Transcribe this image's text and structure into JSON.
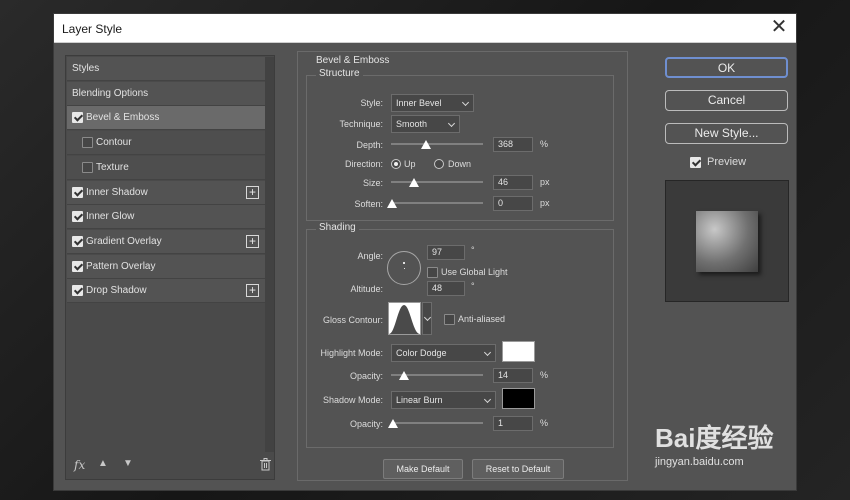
{
  "dialog": {
    "title": "Layer Style"
  },
  "styles_list": {
    "items": [
      {
        "label": "Styles",
        "checkbox": false,
        "checked": false,
        "plus": false,
        "active": false,
        "sub": false
      },
      {
        "label": "Blending Options",
        "checkbox": false,
        "checked": false,
        "plus": false,
        "active": false,
        "sub": false
      },
      {
        "label": "Bevel & Emboss",
        "checkbox": true,
        "checked": true,
        "plus": false,
        "active": true,
        "sub": false
      },
      {
        "label": "Contour",
        "checkbox": true,
        "checked": false,
        "plus": false,
        "active": false,
        "sub": true
      },
      {
        "label": "Texture",
        "checkbox": true,
        "checked": false,
        "plus": false,
        "active": false,
        "sub": true
      },
      {
        "label": "Inner Shadow",
        "checkbox": true,
        "checked": true,
        "plus": true,
        "active": false,
        "sub": false
      },
      {
        "label": "Inner Glow",
        "checkbox": true,
        "checked": true,
        "plus": false,
        "active": false,
        "sub": false
      },
      {
        "label": "Gradient Overlay",
        "checkbox": true,
        "checked": true,
        "plus": true,
        "active": false,
        "sub": false
      },
      {
        "label": "Pattern Overlay",
        "checkbox": true,
        "checked": true,
        "plus": false,
        "active": false,
        "sub": false
      },
      {
        "label": "Drop Shadow",
        "checkbox": true,
        "checked": true,
        "plus": true,
        "active": false,
        "sub": false
      }
    ],
    "fx_label": "fx"
  },
  "bevel": {
    "title": "Bevel & Emboss",
    "structure": {
      "title": "Structure",
      "style_label": "Style:",
      "style_value": "Inner Bevel",
      "technique_label": "Technique:",
      "technique_value": "Smooth",
      "depth_label": "Depth:",
      "depth_value": "368",
      "depth_unit": "%",
      "direction_label": "Direction:",
      "direction_up": "Up",
      "direction_down": "Down",
      "direction_selected": "Up",
      "size_label": "Size:",
      "size_value": "46",
      "size_unit": "px",
      "soften_label": "Soften:",
      "soften_value": "0",
      "soften_unit": "px"
    },
    "shading": {
      "title": "Shading",
      "angle_label": "Angle:",
      "angle_value": "97",
      "angle_unit": "°",
      "global_light_label": "Use Global Light",
      "global_light_checked": false,
      "altitude_label": "Altitude:",
      "altitude_value": "48",
      "altitude_unit": "°",
      "gloss_label": "Gloss Contour:",
      "antialiased_label": "Anti-aliased",
      "antialiased_checked": false,
      "highlight_mode_label": "Highlight Mode:",
      "highlight_mode_value": "Color Dodge",
      "highlight_color": "#ffffff",
      "highlight_opacity_label": "Opacity:",
      "highlight_opacity_value": "14",
      "highlight_opacity_unit": "%",
      "shadow_mode_label": "Shadow Mode:",
      "shadow_mode_value": "Linear Burn",
      "shadow_color": "#000000",
      "shadow_opacity_label": "Opacity:",
      "shadow_opacity_value": "1",
      "shadow_opacity_unit": "%"
    },
    "make_default": "Make Default",
    "reset_default": "Reset to Default"
  },
  "actions": {
    "ok": "OK",
    "cancel": "Cancel",
    "new_style": "New Style...",
    "preview_label": "Preview",
    "preview_checked": true
  },
  "watermark": {
    "brand": "Bai度经验",
    "url": "jingyan.baidu.com"
  }
}
